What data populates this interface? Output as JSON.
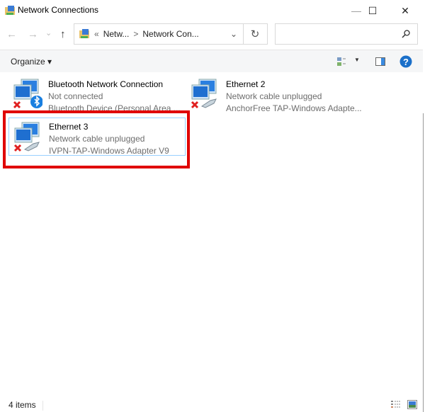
{
  "window": {
    "title": "Network Connections",
    "minimize": "—",
    "maximize": "☐",
    "close": "✕"
  },
  "nav": {
    "back": "←",
    "forward": "→",
    "recent": "⌄",
    "up": "↑",
    "refresh": "↻",
    "breadcrumb_sep": "«",
    "crumbs": [
      "Netw...",
      "Network Con..."
    ],
    "chevron": ">",
    "dropdown": "⌄",
    "search_placeholder": ""
  },
  "toolbar": {
    "organize": "Organize ▾"
  },
  "items": [
    {
      "name": "Bluetooth Network Connection",
      "status": "Not connected",
      "device": "Bluetooth Device (Personal Area ..."
    },
    {
      "name": "Ethernet 2",
      "status": "Network cable unplugged",
      "device": "AnchorFree TAP-Windows Adapte..."
    },
    {
      "name": "Ethernet 3",
      "status": "Network cable unplugged",
      "device": "IVPN-TAP-Windows Adapter V9"
    }
  ],
  "status": {
    "count": "4 items"
  },
  "colors": {
    "highlight": "#e00000",
    "selection": "#99d1ff",
    "help": "#1a6fc9"
  }
}
